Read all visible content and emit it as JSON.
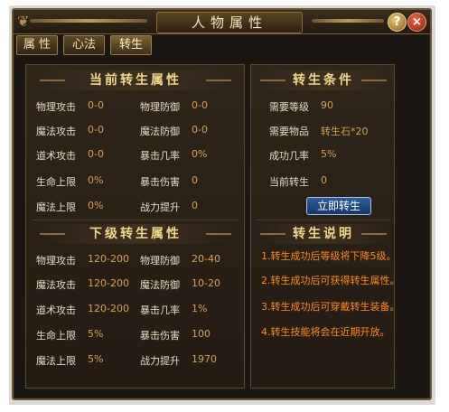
{
  "window": {
    "title": "人物属性",
    "help_label": "?",
    "close_label": "×"
  },
  "tabs": [
    {
      "label": "属 性"
    },
    {
      "label": "心法"
    },
    {
      "label": "转生"
    }
  ],
  "current": {
    "title": "当前转生属性",
    "rows": [
      {
        "l1": "物理攻击",
        "v1": "0-0",
        "l2": "物理防御",
        "v2": "0-0"
      },
      {
        "l1": "魔法攻击",
        "v1": "0-0",
        "l2": "魔法防御",
        "v2": "0-0"
      },
      {
        "l1": "道术攻击",
        "v1": "0-0",
        "l2": "暴击几率",
        "v2": "0%"
      },
      {
        "l1": "生命上限",
        "v1": "0%",
        "l2": "暴击伤害",
        "v2": "0"
      },
      {
        "l1": "魔法上限",
        "v1": "0%",
        "l2": "战力提升",
        "v2": "0"
      }
    ]
  },
  "next": {
    "title": "下级转生属性",
    "rows": [
      {
        "l1": "物理攻击",
        "v1": "120-200",
        "l2": "物理防御",
        "v2": "20-40"
      },
      {
        "l1": "魔法攻击",
        "v1": "120-200",
        "l2": "魔法防御",
        "v2": "10-20"
      },
      {
        "l1": "道术攻击",
        "v1": "120-200",
        "l2": "暴击几率",
        "v2": "1%"
      },
      {
        "l1": "生命上限",
        "v1": "5%",
        "l2": "暴击伤害",
        "v2": "100"
      },
      {
        "l1": "魔法上限",
        "v1": "5%",
        "l2": "战力提升",
        "v2": "1970"
      }
    ]
  },
  "conditions": {
    "title": "转生条件",
    "rows": [
      {
        "label": "需要等级",
        "value": "90"
      },
      {
        "label": "需要物品",
        "value": "转生石*20"
      },
      {
        "label": "成功几率",
        "value": "5%"
      },
      {
        "label": "当前转生",
        "value": "0"
      }
    ],
    "button_label": "立即转生"
  },
  "explanation": {
    "title": "转生说明",
    "lines": [
      "1.转生成功后等级将下降5级。",
      "2.转生成功后可获得转生属性。",
      "3.转生成功后可穿戴转生装备。",
      "4.转生技能将会在近期开放。"
    ]
  }
}
